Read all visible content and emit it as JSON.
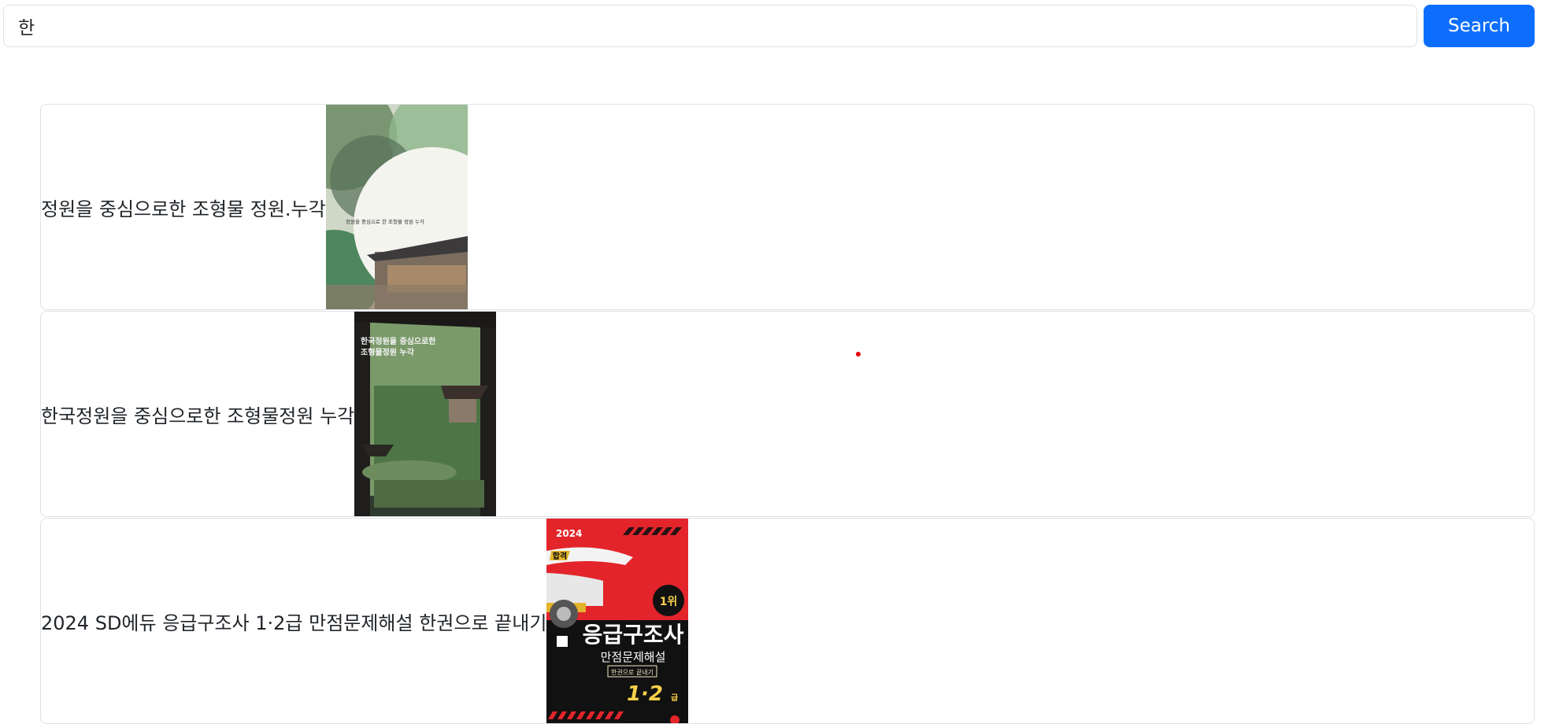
{
  "search": {
    "value": "한",
    "button_label": "Search"
  },
  "results": [
    {
      "title": "정원을 중심으로한 조형물 정원.누각",
      "cover_text": "정원을 중심으로 한 조형물 정원 누각"
    },
    {
      "title": "한국정원을 중심으로한 조형물정원 누각",
      "cover_text": [
        "한국정원을 중심으로한",
        "조형물정원 누각"
      ]
    },
    {
      "title": "2024 SD에듀 응급구조사 1·2급 만점문제해설 한권으로 끝내기",
      "cover_text": {
        "year": "2024",
        "big": "응급구조사",
        "sub": "만점문제해설",
        "grade": "1·2",
        "grade_unit": "급",
        "badge": "1위",
        "tag": "한권으로 끝내기"
      }
    }
  ],
  "colors": {
    "accent": "#0d6efd",
    "border": "#dee2e6",
    "dot": "#e8000b"
  }
}
